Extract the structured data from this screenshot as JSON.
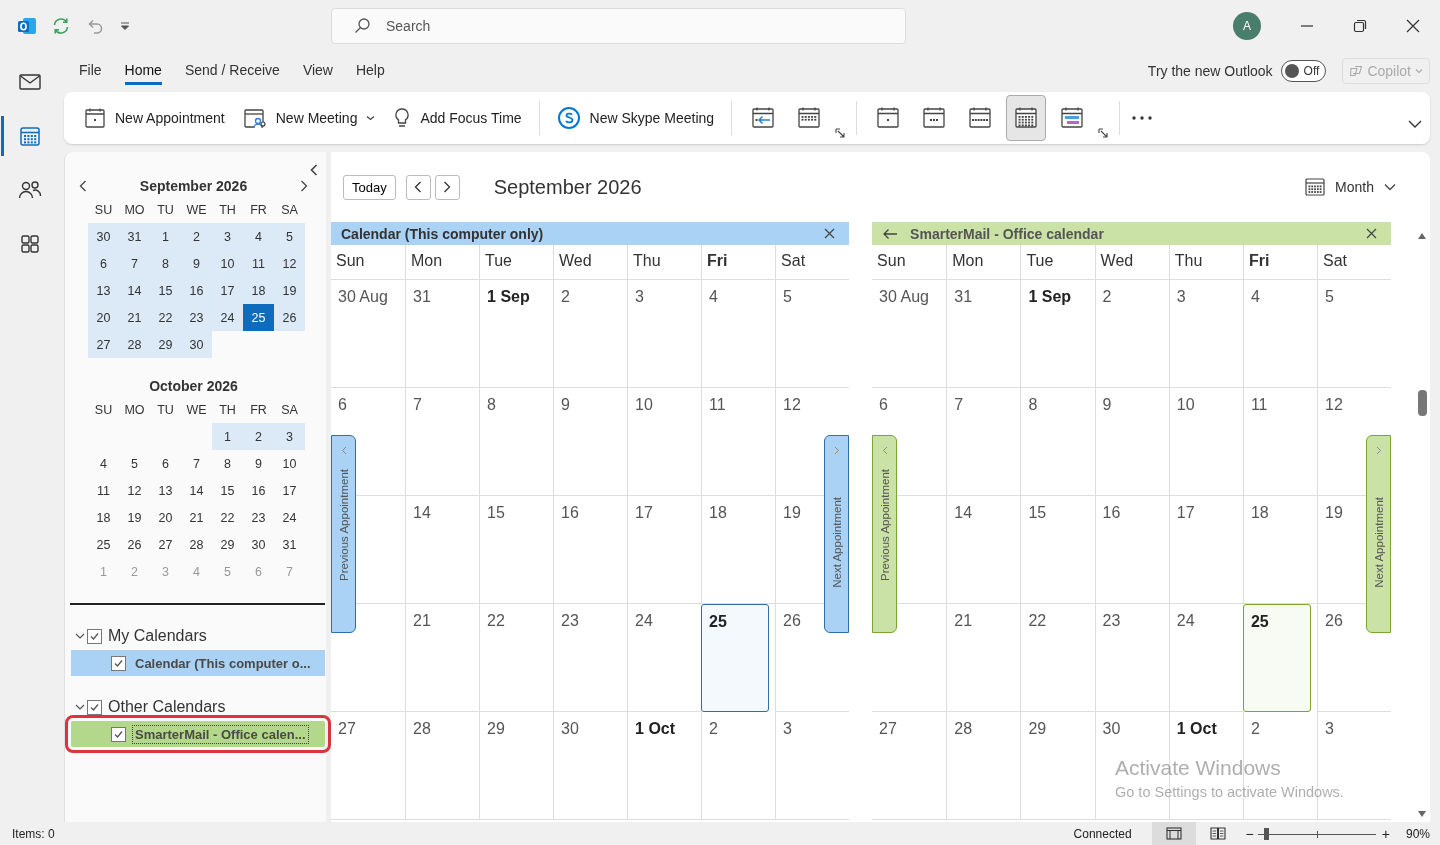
{
  "title_bar": {
    "search": {
      "placeholder": "Search"
    },
    "avatar": "A"
  },
  "nav_rail": [
    {
      "kind": "mail",
      "selected": false
    },
    {
      "kind": "calendar",
      "selected": true
    },
    {
      "kind": "people",
      "selected": false
    },
    {
      "kind": "apps",
      "selected": false
    }
  ],
  "menu": {
    "tabs": [
      {
        "label": "File",
        "selected": false
      },
      {
        "label": "Home",
        "selected": true
      },
      {
        "label": "Send / Receive",
        "selected": false
      },
      {
        "label": "View",
        "selected": false
      },
      {
        "label": "Help",
        "selected": false
      }
    ],
    "new_outlook": {
      "label": "Try the new Outlook",
      "on": false,
      "state_text": "Off"
    },
    "copilot": {
      "label": "Copilot",
      "disabled": true
    }
  },
  "ribbon": {
    "commands": [
      {
        "kind": "appointment",
        "label": "New Appointment",
        "dropdown": false
      },
      {
        "kind": "meeting",
        "label": "New Meeting",
        "dropdown": true
      },
      {
        "kind": "focus",
        "label": "Add Focus Time",
        "dropdown": false
      },
      {
        "kind": "skype",
        "label": "New Skype Meeting",
        "dropdown": false
      }
    ],
    "groups": [
      {
        "buttons": [
          {
            "kind": "today",
            "selected": false
          },
          {
            "kind": "next7",
            "selected": false
          }
        ]
      },
      {
        "buttons": [
          {
            "kind": "day",
            "selected": false
          },
          {
            "kind": "workweek",
            "selected": false
          },
          {
            "kind": "week",
            "selected": false
          },
          {
            "kind": "month",
            "selected": true
          },
          {
            "kind": "schedule",
            "selected": false
          }
        ]
      }
    ]
  },
  "navigator": {
    "months": [
      {
        "title": "September 2026",
        "weekdays": [
          "SU",
          "MO",
          "TU",
          "WE",
          "TH",
          "FR",
          "SA"
        ],
        "days": [
          {
            "kind": "date",
            "label": "30",
            "highlighted": true,
            "selected": false,
            "dim": false
          },
          {
            "kind": "date",
            "label": "31",
            "highlighted": true,
            "selected": false,
            "dim": false
          },
          {
            "kind": "date",
            "label": "1",
            "highlighted": true,
            "selected": false,
            "dim": false
          },
          {
            "kind": "date",
            "label": "2",
            "highlighted": true,
            "selected": false,
            "dim": false
          },
          {
            "kind": "date",
            "label": "3",
            "highlighted": true,
            "selected": false,
            "dim": false
          },
          {
            "kind": "date",
            "label": "4",
            "highlighted": true,
            "selected": false,
            "dim": false
          },
          {
            "kind": "date",
            "label": "5",
            "highlighted": true,
            "selected": false,
            "dim": false
          },
          {
            "kind": "date",
            "label": "6",
            "highlighted": true,
            "selected": false,
            "dim": false
          },
          {
            "kind": "date",
            "label": "7",
            "highlighted": true,
            "selected": false,
            "dim": false
          },
          {
            "kind": "date",
            "label": "8",
            "highlighted": true,
            "selected": false,
            "dim": false
          },
          {
            "kind": "date",
            "label": "9",
            "highlighted": true,
            "selected": false,
            "dim": false
          },
          {
            "kind": "date",
            "label": "10",
            "highlighted": true,
            "selected": false,
            "dim": false
          },
          {
            "kind": "date",
            "label": "11",
            "highlighted": true,
            "selected": false,
            "dim": false
          },
          {
            "kind": "date",
            "label": "12",
            "highlighted": true,
            "selected": false,
            "dim": false
          },
          {
            "kind": "date",
            "label": "13",
            "highlighted": true,
            "selected": false,
            "dim": false
          },
          {
            "kind": "date",
            "label": "14",
            "highlighted": true,
            "selected": false,
            "dim": false
          },
          {
            "kind": "date",
            "label": "15",
            "highlighted": true,
            "selected": false,
            "dim": false
          },
          {
            "kind": "date",
            "label": "16",
            "highlighted": true,
            "selected": false,
            "dim": false
          },
          {
            "kind": "date",
            "label": "17",
            "highlighted": true,
            "selected": false,
            "dim": false
          },
          {
            "kind": "date",
            "label": "18",
            "highlighted": true,
            "selected": false,
            "dim": false
          },
          {
            "kind": "date",
            "label": "19",
            "highlighted": true,
            "selected": false,
            "dim": false
          },
          {
            "kind": "date",
            "label": "20",
            "highlighted": true,
            "selected": false,
            "dim": false
          },
          {
            "kind": "date",
            "label": "21",
            "highlighted": true,
            "selected": false,
            "dim": false
          },
          {
            "kind": "date",
            "label": "22",
            "highlighted": true,
            "selected": false,
            "dim": false
          },
          {
            "kind": "date",
            "label": "23",
            "highlighted": true,
            "selected": false,
            "dim": false
          },
          {
            "kind": "date",
            "label": "24",
            "highlighted": true,
            "selected": false,
            "dim": false
          },
          {
            "kind": "date",
            "label": "25",
            "highlighted": true,
            "selected": true,
            "dim": false
          },
          {
            "kind": "date",
            "label": "26",
            "highlighted": true,
            "selected": false,
            "dim": false
          },
          {
            "kind": "date",
            "label": "27",
            "highlighted": true,
            "selected": false,
            "dim": false
          },
          {
            "kind": "date",
            "label": "28",
            "highlighted": true,
            "selected": false,
            "dim": false
          },
          {
            "kind": "date",
            "label": "29",
            "highlighted": true,
            "selected": false,
            "dim": false
          },
          {
            "kind": "date",
            "label": "30",
            "highlighted": true,
            "selected": false,
            "dim": false
          }
        ]
      },
      {
        "title": "October 2026",
        "weekdays": [
          "SU",
          "MO",
          "TU",
          "WE",
          "TH",
          "FR",
          "SA"
        ],
        "days": [
          {
            "kind": "blank"
          },
          {
            "kind": "blank"
          },
          {
            "kind": "blank"
          },
          {
            "kind": "blank"
          },
          {
            "kind": "date",
            "label": "1",
            "highlighted": true,
            "selected": false,
            "dim": false
          },
          {
            "kind": "date",
            "label": "2",
            "highlighted": true,
            "selected": false,
            "dim": false
          },
          {
            "kind": "date",
            "label": "3",
            "highlighted": true,
            "selected": false,
            "dim": false
          },
          {
            "kind": "date",
            "label": "4",
            "highlighted": false,
            "selected": false,
            "dim": false
          },
          {
            "kind": "date",
            "label": "5",
            "highlighted": false,
            "selected": false,
            "dim": false
          },
          {
            "kind": "date",
            "label": "6",
            "highlighted": false,
            "selected": false,
            "dim": false
          },
          {
            "kind": "date",
            "label": "7",
            "highlighted": false,
            "selected": false,
            "dim": false
          },
          {
            "kind": "date",
            "label": "8",
            "highlighted": false,
            "selected": false,
            "dim": false
          },
          {
            "kind": "date",
            "label": "9",
            "highlighted": false,
            "selected": false,
            "dim": false
          },
          {
            "kind": "date",
            "label": "10",
            "highlighted": false,
            "selected": false,
            "dim": false
          },
          {
            "kind": "date",
            "label": "11",
            "highlighted": false,
            "selected": false,
            "dim": false
          },
          {
            "kind": "date",
            "label": "12",
            "highlighted": false,
            "selected": false,
            "dim": false
          },
          {
            "kind": "date",
            "label": "13",
            "highlighted": false,
            "selected": false,
            "dim": false
          },
          {
            "kind": "date",
            "label": "14",
            "highlighted": false,
            "selected": false,
            "dim": false
          },
          {
            "kind": "date",
            "label": "15",
            "highlighted": false,
            "selected": false,
            "dim": false
          },
          {
            "kind": "date",
            "label": "16",
            "highlighted": false,
            "selected": false,
            "dim": false
          },
          {
            "kind": "date",
            "label": "17",
            "highlighted": false,
            "selected": false,
            "dim": false
          },
          {
            "kind": "date",
            "label": "18",
            "highlighted": false,
            "selected": false,
            "dim": false
          },
          {
            "kind": "date",
            "label": "19",
            "highlighted": false,
            "selected": false,
            "dim": false
          },
          {
            "kind": "date",
            "label": "20",
            "highlighted": false,
            "selected": false,
            "dim": false
          },
          {
            "kind": "date",
            "label": "21",
            "highlighted": false,
            "selected": false,
            "dim": false
          },
          {
            "kind": "date",
            "label": "22",
            "highlighted": false,
            "selected": false,
            "dim": false
          },
          {
            "kind": "date",
            "label": "23",
            "highlighted": false,
            "selected": false,
            "dim": false
          },
          {
            "kind": "date",
            "label": "24",
            "highlighted": false,
            "selected": false,
            "dim": false
          },
          {
            "kind": "date",
            "label": "25",
            "highlighted": false,
            "selected": false,
            "dim": false
          },
          {
            "kind": "date",
            "label": "26",
            "highlighted": false,
            "selected": false,
            "dim": false
          },
          {
            "kind": "date",
            "label": "27",
            "highlighted": false,
            "selected": false,
            "dim": false
          },
          {
            "kind": "date",
            "label": "28",
            "highlighted": false,
            "selected": false,
            "dim": false
          },
          {
            "kind": "date",
            "label": "29",
            "highlighted": false,
            "selected": false,
            "dim": false
          },
          {
            "kind": "date",
            "label": "30",
            "highlighted": false,
            "selected": false,
            "dim": false
          },
          {
            "kind": "date",
            "label": "31",
            "highlighted": false,
            "selected": false,
            "dim": false
          },
          {
            "kind": "date",
            "label": "1",
            "highlighted": false,
            "selected": false,
            "dim": true
          },
          {
            "kind": "date",
            "label": "2",
            "highlighted": false,
            "selected": false,
            "dim": true
          },
          {
            "kind": "date",
            "label": "3",
            "highlighted": false,
            "selected": false,
            "dim": true
          },
          {
            "kind": "date",
            "label": "4",
            "highlighted": false,
            "selected": false,
            "dim": true
          },
          {
            "kind": "date",
            "label": "5",
            "highlighted": false,
            "selected": false,
            "dim": true
          },
          {
            "kind": "date",
            "label": "6",
            "highlighted": false,
            "selected": false,
            "dim": true
          },
          {
            "kind": "date",
            "label": "7",
            "highlighted": false,
            "selected": false,
            "dim": true
          }
        ]
      }
    ]
  },
  "folders": [
    {
      "label": "My Calendars",
      "checked": true,
      "expanded": true,
      "items": [
        {
          "label": "Calendar (This computer o...",
          "checked": true,
          "color": "#a9d2f5",
          "outlined": false
        }
      ]
    },
    {
      "label": "Other Calendars",
      "checked": true,
      "expanded": true,
      "items": [
        {
          "label": "SmarterMail - Office calen...",
          "checked": true,
          "color": "#b3d78b",
          "outlined": true
        }
      ]
    }
  ],
  "toolbar": {
    "today": "Today",
    "title": "September 2026",
    "view": "Month"
  },
  "calendars": [
    {
      "title": "Calendar (This computer only)",
      "color": "#a9d2f5",
      "back_arrow": false,
      "prev_tab": "Previous Appointment",
      "next_tab": "Next Appointment",
      "weekdays": [
        {
          "label": "Sun",
          "bold": false
        },
        {
          "label": "Mon",
          "bold": false
        },
        {
          "label": "Tue",
          "bold": false
        },
        {
          "label": "Wed",
          "bold": false
        },
        {
          "label": "Thu",
          "bold": false
        },
        {
          "label": "Fri",
          "bold": true
        },
        {
          "label": "Sat",
          "bold": false
        }
      ],
      "days": [
        {
          "kind": "date",
          "label": "30 Aug",
          "bold": false,
          "today": false
        },
        {
          "kind": "date",
          "label": "31",
          "bold": false,
          "today": false
        },
        {
          "kind": "date",
          "label": "1 Sep",
          "bold": true,
          "today": false
        },
        {
          "kind": "date",
          "label": "2",
          "bold": false,
          "today": false
        },
        {
          "kind": "date",
          "label": "3",
          "bold": false,
          "today": false
        },
        {
          "kind": "date",
          "label": "4",
          "bold": false,
          "today": false
        },
        {
          "kind": "date",
          "label": "5",
          "bold": false,
          "today": false
        },
        {
          "kind": "date",
          "label": "6",
          "bold": false,
          "today": false
        },
        {
          "kind": "date",
          "label": "7",
          "bold": false,
          "today": false
        },
        {
          "kind": "date",
          "label": "8",
          "bold": false,
          "today": false
        },
        {
          "kind": "date",
          "label": "9",
          "bold": false,
          "today": false
        },
        {
          "kind": "date",
          "label": "10",
          "bold": false,
          "today": false
        },
        {
          "kind": "date",
          "label": "11",
          "bold": false,
          "today": false
        },
        {
          "kind": "date",
          "label": "12",
          "bold": false,
          "today": false
        },
        {
          "kind": "covered"
        },
        {
          "kind": "date",
          "label": "14",
          "bold": false,
          "today": false
        },
        {
          "kind": "date",
          "label": "15",
          "bold": false,
          "today": false
        },
        {
          "kind": "date",
          "label": "16",
          "bold": false,
          "today": false
        },
        {
          "kind": "date",
          "label": "17",
          "bold": false,
          "today": false
        },
        {
          "kind": "date",
          "label": "18",
          "bold": false,
          "today": false
        },
        {
          "kind": "date",
          "label": "19",
          "bold": false,
          "today": false
        },
        {
          "kind": "covered"
        },
        {
          "kind": "date",
          "label": "21",
          "bold": false,
          "today": false
        },
        {
          "kind": "date",
          "label": "22",
          "bold": false,
          "today": false
        },
        {
          "kind": "date",
          "label": "23",
          "bold": false,
          "today": false
        },
        {
          "kind": "date",
          "label": "24",
          "bold": false,
          "today": false
        },
        {
          "kind": "date",
          "label": "25",
          "bold": true,
          "today": true
        },
        {
          "kind": "date",
          "label": "26",
          "bold": false,
          "today": false
        },
        {
          "kind": "date",
          "label": "27",
          "bold": false,
          "today": false
        },
        {
          "kind": "date",
          "label": "28",
          "bold": false,
          "today": false
        },
        {
          "kind": "date",
          "label": "29",
          "bold": false,
          "today": false
        },
        {
          "kind": "date",
          "label": "30",
          "bold": false,
          "today": false
        },
        {
          "kind": "date",
          "label": "1 Oct",
          "bold": true,
          "today": false
        },
        {
          "kind": "date",
          "label": "2",
          "bold": false,
          "today": false
        },
        {
          "kind": "date",
          "label": "3",
          "bold": false,
          "today": false
        }
      ]
    },
    {
      "title": "SmarterMail - Office calendar",
      "color": "#cbe2a6",
      "back_arrow": true,
      "prev_tab": "Previous Appointment",
      "next_tab": "Next Appointment",
      "weekdays": [
        {
          "label": "Sun",
          "bold": false
        },
        {
          "label": "Mon",
          "bold": false
        },
        {
          "label": "Tue",
          "bold": false
        },
        {
          "label": "Wed",
          "bold": false
        },
        {
          "label": "Thu",
          "bold": false
        },
        {
          "label": "Fri",
          "bold": true
        },
        {
          "label": "Sat",
          "bold": false
        }
      ],
      "days": [
        {
          "kind": "date",
          "label": "30 Aug",
          "bold": false,
          "today": false
        },
        {
          "kind": "date",
          "label": "31",
          "bold": false,
          "today": false
        },
        {
          "kind": "date",
          "label": "1 Sep",
          "bold": true,
          "today": false
        },
        {
          "kind": "date",
          "label": "2",
          "bold": false,
          "today": false
        },
        {
          "kind": "date",
          "label": "3",
          "bold": false,
          "today": false
        },
        {
          "kind": "date",
          "label": "4",
          "bold": false,
          "today": false
        },
        {
          "kind": "date",
          "label": "5",
          "bold": false,
          "today": false
        },
        {
          "kind": "date",
          "label": "6",
          "bold": false,
          "today": false
        },
        {
          "kind": "date",
          "label": "7",
          "bold": false,
          "today": false
        },
        {
          "kind": "date",
          "label": "8",
          "bold": false,
          "today": false
        },
        {
          "kind": "date",
          "label": "9",
          "bold": false,
          "today": false
        },
        {
          "kind": "date",
          "label": "10",
          "bold": false,
          "today": false
        },
        {
          "kind": "date",
          "label": "11",
          "bold": false,
          "today": false
        },
        {
          "kind": "date",
          "label": "12",
          "bold": false,
          "today": false
        },
        {
          "kind": "covered"
        },
        {
          "kind": "date",
          "label": "14",
          "bold": false,
          "today": false
        },
        {
          "kind": "date",
          "label": "15",
          "bold": false,
          "today": false
        },
        {
          "kind": "date",
          "label": "16",
          "bold": false,
          "today": false
        },
        {
          "kind": "date",
          "label": "17",
          "bold": false,
          "today": false
        },
        {
          "kind": "date",
          "label": "18",
          "bold": false,
          "today": false
        },
        {
          "kind": "date",
          "label": "19",
          "bold": false,
          "today": false
        },
        {
          "kind": "covered"
        },
        {
          "kind": "date",
          "label": "21",
          "bold": false,
          "today": false
        },
        {
          "kind": "date",
          "label": "22",
          "bold": false,
          "today": false
        },
        {
          "kind": "date",
          "label": "23",
          "bold": false,
          "today": false
        },
        {
          "kind": "date",
          "label": "24",
          "bold": false,
          "today": false
        },
        {
          "kind": "date",
          "label": "25",
          "bold": true,
          "today": true
        },
        {
          "kind": "date",
          "label": "26",
          "bold": false,
          "today": false
        },
        {
          "kind": "date",
          "label": "27",
          "bold": false,
          "today": false
        },
        {
          "kind": "date",
          "label": "28",
          "bold": false,
          "today": false
        },
        {
          "kind": "date",
          "label": "29",
          "bold": false,
          "today": false
        },
        {
          "kind": "date",
          "label": "30",
          "bold": false,
          "today": false
        },
        {
          "kind": "date",
          "label": "1 Oct",
          "bold": true,
          "today": false
        },
        {
          "kind": "date",
          "label": "2",
          "bold": false,
          "today": false
        },
        {
          "kind": "date",
          "label": "3",
          "bold": false,
          "today": false
        }
      ]
    }
  ],
  "watermark": {
    "title": "Activate Windows",
    "text": "Go to Settings to activate Windows."
  },
  "status_bar": {
    "items": "Items: 0",
    "connection": "Connected",
    "views": [
      {
        "kind": "normal",
        "selected": true
      },
      {
        "kind": "reading",
        "selected": false
      }
    ],
    "zoom": {
      "minus": "−",
      "plus": "+",
      "level": 0.05,
      "reading": "90%"
    }
  }
}
